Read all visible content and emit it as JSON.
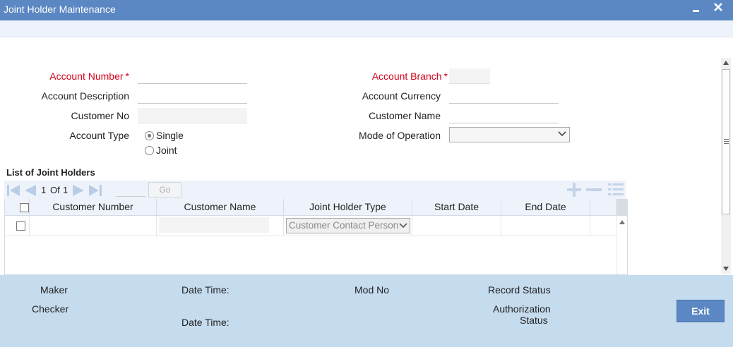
{
  "window": {
    "title": "Joint Holder Maintenance",
    "minimize_icon": "minimize-icon",
    "close_icon": "close-icon"
  },
  "form": {
    "account_number_label": "Account Number",
    "account_branch_label": "Account Branch",
    "account_description_label": "Account Description",
    "account_currency_label": "Account Currency",
    "customer_no_label": "Customer No",
    "customer_name_label": "Customer Name",
    "account_type_label": "Account Type",
    "mode_of_operation_label": "Mode of Operation",
    "required_marker": "*",
    "account_type_options": [
      {
        "label": "Single",
        "selected": true
      },
      {
        "label": "Joint",
        "selected": false
      }
    ],
    "account_number_value": "",
    "account_branch_value": "",
    "account_description_value": "",
    "account_currency_value": "",
    "customer_no_value": "",
    "customer_name_value": "",
    "mode_of_operation_value": ""
  },
  "joint_holders": {
    "section_title": "List of Joint Holders",
    "pagination": {
      "current": "1",
      "of_label": "Of",
      "total": "1"
    },
    "go_label": "Go",
    "columns": [
      "Customer Number",
      "Customer Name",
      "Joint Holder Type",
      "Start Date",
      "End Date"
    ],
    "rows": [
      {
        "customer_number": "",
        "customer_name": "",
        "joint_holder_type": "Customer Contact Person",
        "start_date": "",
        "end_date": ""
      }
    ]
  },
  "footer": {
    "maker_label": "Maker",
    "checker_label": "Checker",
    "date_time_label": "Date Time:",
    "mod_no_label": "Mod No",
    "record_status_label": "Record Status",
    "authorization_label": "Authorization",
    "status_label": "Status",
    "exit_label": "Exit"
  },
  "colors": {
    "title_bar": "#5b87c3",
    "required_label": "#d0021b",
    "footer_bg": "#c5dbee",
    "toolbar_bg": "#eef3fb"
  }
}
